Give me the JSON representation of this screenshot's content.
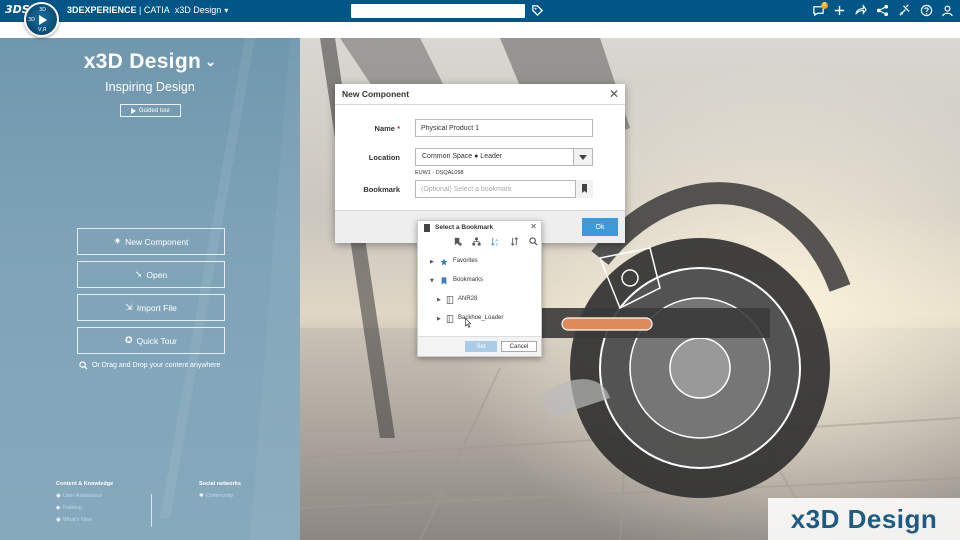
{
  "topbar": {
    "brand_logo_text": "3DS",
    "compass_top": "3D",
    "compass_left": "3D",
    "compass_bottom": "V,R",
    "brand": "3DEXPERIENCE",
    "separator": " | ",
    "product": "CATIA",
    "app": "x3D Design",
    "search_value": "",
    "notification_count": "8",
    "icons": [
      "tag-icon",
      "chat-icon",
      "plus-icon",
      "share-icon",
      "network-icon",
      "tools-icon",
      "help-icon",
      "user-icon"
    ]
  },
  "left_panel": {
    "title": "x3D Design",
    "subtitle": "Inspiring Design",
    "guided_tour": "Guided tour",
    "buttons": [
      {
        "label": "New Component",
        "icon": "sparkle-icon"
      },
      {
        "label": "Open",
        "icon": "open-arrow-icon"
      },
      {
        "label": "Import File",
        "icon": "import-icon"
      },
      {
        "label": "Quick Tour",
        "icon": "graduation-icon"
      }
    ],
    "drag_hint": "Or Drag and Drop your content anywhere",
    "footer": {
      "content_heading": "Content & Knowledge",
      "content_links": [
        "User Assistance",
        "Training",
        "What's New"
      ],
      "social_heading": "Social networks",
      "social_links": [
        "Community"
      ]
    }
  },
  "brand_badge": "x3D Design",
  "dialog": {
    "title": "New Component",
    "name_label": "Name",
    "name_required": "*",
    "name_value": "Physical Product 1",
    "location_label": "Location",
    "location_value": "Common Space ● Leader",
    "location_hint": "EUW1 - DSQAL098",
    "bookmark_label": "Bookmark",
    "bookmark_placeholder": "(Optional) Select a bookmark",
    "ok_label": "Ok"
  },
  "bookmark_popup": {
    "title": "Select a Bookmark",
    "tree": [
      {
        "label": "Favorites",
        "icon": "star-icon",
        "expanded": false,
        "level": 0
      },
      {
        "label": "Bookmarks",
        "icon": "bookmark-icon",
        "expanded": true,
        "level": 0
      },
      {
        "label": "ANR28",
        "icon": "folder-bookmark-icon",
        "expanded": false,
        "level": 1
      },
      {
        "label": "Backhoe_Loader",
        "icon": "folder-bookmark-icon",
        "expanded": false,
        "level": 1
      }
    ],
    "set_label": "Set",
    "cancel_label": "Cancel"
  },
  "colors": {
    "topbar": "#005686",
    "accent": "#3d9ad6",
    "panel": "#7ea3b8",
    "badge_text": "#1e5b82"
  }
}
